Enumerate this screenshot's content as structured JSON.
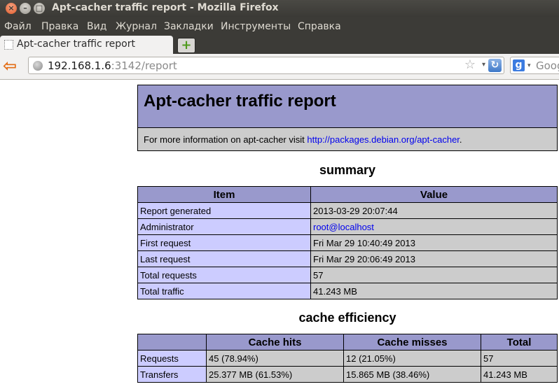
{
  "window": {
    "title": "Apt-cacher traffic report - Mozilla Firefox",
    "close_glyph": "×",
    "minimize_glyph": "–",
    "maximize_glyph": "□"
  },
  "menu": [
    "Файл",
    "Правка",
    "Вид",
    "Журнал",
    "Закладки",
    "Инструменты",
    "Справка"
  ],
  "tab": {
    "title": "Apt-cacher traffic report",
    "new_tab_glyph": "+"
  },
  "navbar": {
    "back_glyph": "⇦",
    "url_host": "192.168.1.6",
    "url_rest": ":3142/report",
    "star_glyph": "☆",
    "dropdown_glyph": "▾",
    "reload_glyph": "↻",
    "search_engine_glyph": "g",
    "search_placeholder": "Goog"
  },
  "report": {
    "title": "Apt-cacher traffic report",
    "info_prefix": "For more information on apt-cacher visit ",
    "info_link": "http://packages.debian.org/apt-cacher",
    "info_suffix": "."
  },
  "summary": {
    "heading": "summary",
    "col_item": "Item",
    "col_value": "Value",
    "rows": [
      {
        "item": "Report generated",
        "value": "2013-03-29 20:07:44"
      },
      {
        "item": "Administrator",
        "value": "root@localhost"
      },
      {
        "item": "First request",
        "value": "Fri Mar 29 10:40:49 2013"
      },
      {
        "item": "Last request",
        "value": "Fri Mar 29 20:06:49 2013"
      },
      {
        "item": "Total requests",
        "value": "57"
      },
      {
        "item": "Total traffic",
        "value": "41.243 MB"
      }
    ]
  },
  "cache": {
    "heading": "cache efficiency",
    "col_blank": "",
    "col_hits": "Cache hits",
    "col_misses": "Cache misses",
    "col_total": "Total",
    "rows": [
      {
        "label": "Requests",
        "hits": "45 (78.94%)",
        "misses": "12 (21.05%)",
        "total": "57"
      },
      {
        "label": "Transfers",
        "hits": "25.377 MB (61.53%)",
        "misses": "15.865 MB (38.46%)",
        "total": "41.243 MB"
      }
    ]
  },
  "colors": {
    "header_bg": "#9999cc",
    "key_bg": "#ccccff",
    "value_bg": "#cccccc",
    "link": "#0000ee"
  }
}
